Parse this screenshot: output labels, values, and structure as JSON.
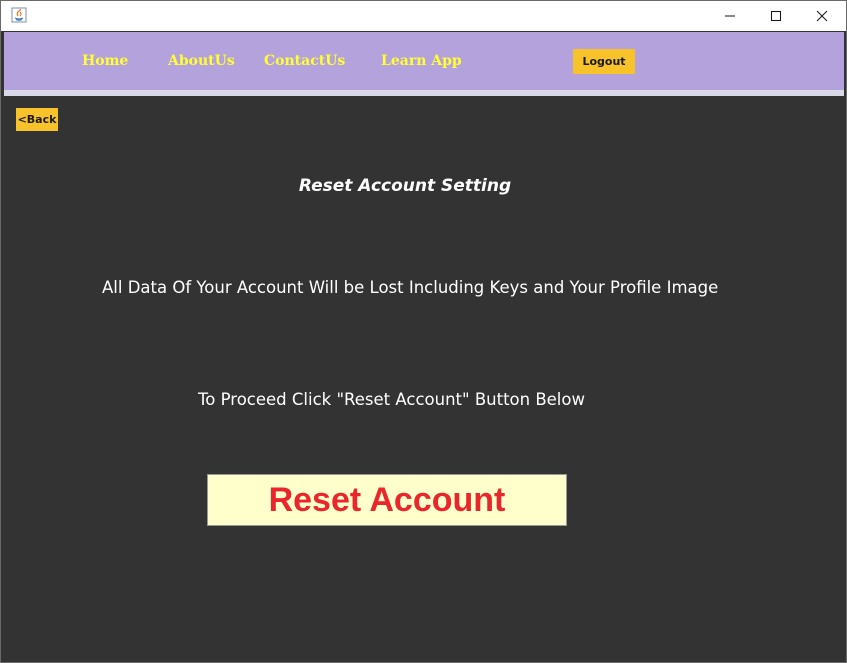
{
  "window": {
    "controls": {
      "minimize_icon": "minimize-icon",
      "maximize_icon": "maximize-icon",
      "close_icon": "close-icon"
    }
  },
  "nav": {
    "items": [
      {
        "label": "Home"
      },
      {
        "label": "AboutUs"
      },
      {
        "label": "ContactUs"
      },
      {
        "label": "Learn App"
      }
    ],
    "logout_label": "Logout"
  },
  "content": {
    "back_label": "<Back",
    "heading": "Reset Account Setting",
    "warning": "All Data Of Your Account Will be Lost Including Keys and Your Profile Image",
    "instruction": "To Proceed Click \"Reset Account\" Button Below",
    "reset_label": "Reset Account"
  },
  "colors": {
    "nav_bg": "#b4a2dc",
    "nav_link": "#ffff33",
    "button_yellow": "#f7c22a",
    "content_bg": "#333333",
    "reset_bg": "#ffffcc",
    "reset_text": "#e8262c"
  }
}
